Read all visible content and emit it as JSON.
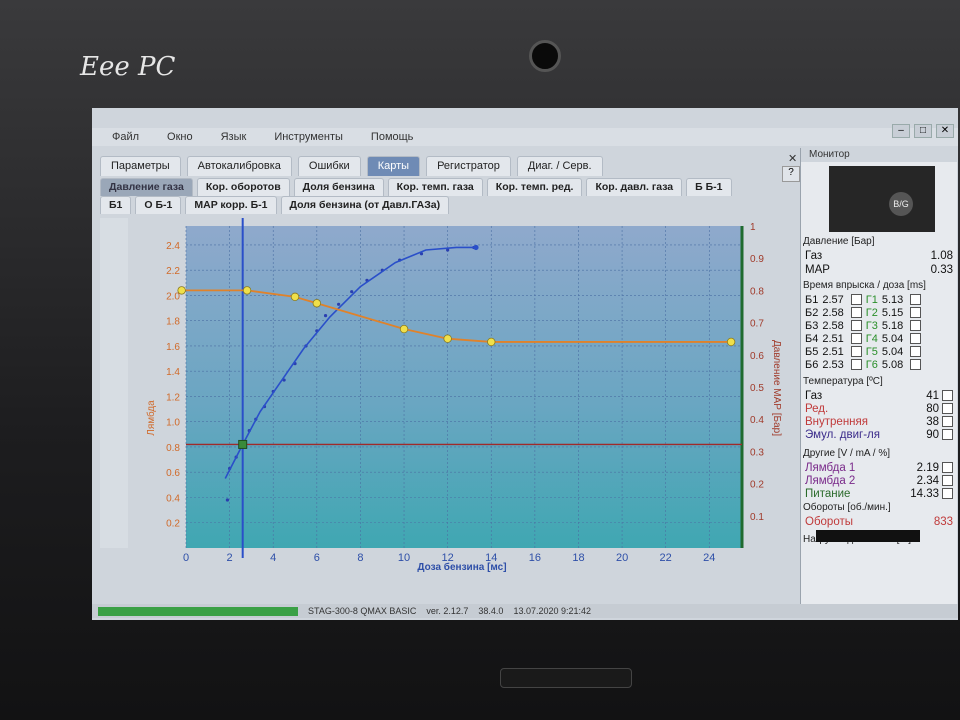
{
  "device": {
    "brand": "Eee PC"
  },
  "menu": {
    "items": [
      "Файл",
      "Окно",
      "Язык",
      "Инструменты",
      "Помощь"
    ]
  },
  "tabs_main": [
    {
      "label": "Параметры",
      "active": false
    },
    {
      "label": "Автокалибровка",
      "active": false
    },
    {
      "label": "Ошибки",
      "active": false
    },
    {
      "label": "Карты",
      "active": true
    },
    {
      "label": "Регистратор",
      "active": false
    },
    {
      "label": "Диаг. / Серв.",
      "active": false
    }
  ],
  "tabs_maps_row1": [
    {
      "label": "Давление газа",
      "selected": true
    },
    {
      "label": "Кор. оборотов",
      "selected": false
    },
    {
      "label": "Доля бензина",
      "selected": false
    },
    {
      "label": "Кор. темп. газа",
      "selected": false
    },
    {
      "label": "Кор. темп. ред.",
      "selected": false
    },
    {
      "label": "Кор. давл. газа",
      "selected": false
    },
    {
      "label": "Б Б-1",
      "selected": false
    }
  ],
  "tabs_maps_row2": [
    {
      "label": "Б1",
      "selected": false
    },
    {
      "label": "О Б-1",
      "selected": false
    },
    {
      "label": "MAP корр. Б-1",
      "selected": false
    },
    {
      "label": "Доля бензина (от Давл.ГАЗа)",
      "selected": false
    }
  ],
  "chart_data": {
    "type": "line",
    "xlabel": "Доза бензина [мс]",
    "ylabel_left": "Лямбда",
    "ylabel_right": "Давление МАР [Бар]",
    "x_ticks": [
      0,
      2,
      4,
      6,
      8,
      10,
      12,
      14,
      16,
      18,
      20,
      22,
      24
    ],
    "y_left_ticks": [
      0.2,
      0.4,
      0.6,
      0.8,
      1.0,
      1.2,
      1.4,
      1.6,
      1.8,
      2.0,
      2.2,
      2.4
    ],
    "y_right_ticks": [
      0.1,
      0.2,
      0.3,
      0.4,
      0.5,
      0.6,
      0.7,
      0.8,
      0.9,
      1
    ],
    "xlim": [
      0,
      25.5
    ],
    "ylim_left": [
      0,
      2.55
    ],
    "ylim_right": [
      0,
      1.0
    ],
    "orange_curve": {
      "x": [
        -0.2,
        2.8,
        5,
        6,
        10,
        12,
        14,
        25
      ],
      "y": [
        0.8,
        0.8,
        0.78,
        0.76,
        0.68,
        0.65,
        0.64,
        0.64
      ]
    },
    "blue_curve": {
      "x": [
        1.8,
        2.6,
        3.4,
        4.4,
        5.4,
        6.6,
        8,
        9.6,
        11,
        12.4,
        13.3
      ],
      "y": [
        0.55,
        0.82,
        1.08,
        1.33,
        1.58,
        1.83,
        2.07,
        2.26,
        2.36,
        2.38,
        2.38
      ]
    },
    "scatter": {
      "x": [
        1.9,
        2.0,
        2.3,
        2.6,
        2.9,
        3.2,
        3.6,
        4.0,
        4.5,
        5.0,
        5.5,
        6.0,
        6.4,
        7.0,
        7.6,
        8.3,
        9.0,
        9.8,
        10.8,
        12.0,
        13.2
      ],
      "y": [
        0.38,
        0.63,
        0.72,
        0.8,
        0.93,
        1.02,
        1.12,
        1.24,
        1.33,
        1.46,
        1.6,
        1.72,
        1.84,
        1.93,
        2.03,
        2.12,
        2.2,
        2.28,
        2.33,
        2.36,
        2.38
      ]
    },
    "cursor_x": 2.6,
    "cursor_y": 0.82,
    "colors": {
      "orange": "#e0822a",
      "blue": "#2a4fc9",
      "red": "#a02a2a",
      "grid": "#4b6fa3"
    }
  },
  "monitor": {
    "title": "Монитор",
    "bg_label": "B/G",
    "pressure_section": "Давление [Бар]",
    "gas_label": "Газ",
    "gas_value": "1.08",
    "map_label": "MAP",
    "map_value": "0.33",
    "inj_section": "Время впрыска / доза [ms]",
    "injectors": [
      {
        "b": "Б1",
        "bv": "2.57",
        "g": "Г1",
        "gv": "5.13"
      },
      {
        "b": "Б2",
        "bv": "2.58",
        "g": "Г2",
        "gv": "5.15"
      },
      {
        "b": "Б3",
        "bv": "2.58",
        "g": "Г3",
        "gv": "5.18"
      },
      {
        "b": "Б4",
        "bv": "2.51",
        "g": "Г4",
        "gv": "5.04"
      },
      {
        "b": "Б5",
        "bv": "2.51",
        "g": "Г5",
        "gv": "5.04"
      },
      {
        "b": "Б6",
        "bv": "2.53",
        "g": "Г6",
        "gv": "5.08"
      }
    ],
    "temp_section": "Температура [ºC]",
    "temps": [
      {
        "label": "Газ",
        "value": "41",
        "color": "#111"
      },
      {
        "label": "Ред.",
        "value": "80",
        "color": "#c03a3a"
      },
      {
        "label": "Внутренняя",
        "value": "38",
        "color": "#c03a3a"
      },
      {
        "label": "Эмул. двиг-ля",
        "value": "90",
        "color": "#3a2a8a"
      }
    ],
    "other_section": "Другие [V / mA / %]",
    "others": [
      {
        "label": "Лямбда 1",
        "value": "2.19",
        "color": "#7a2a8a"
      },
      {
        "label": "Лямбда 2",
        "value": "2.34",
        "color": "#7a2a8a"
      },
      {
        "label": "Питание",
        "value": "14.33",
        "color": "#2a6a2a"
      }
    ],
    "rpm_section": "Обороты [об./мин.]",
    "rpm_label": "Обороты",
    "rpm_value": "833",
    "load_section": "Нагрузка двигателя [%]"
  },
  "status": {
    "text": "STAG-300-8 QMAX BASIC",
    "version": "ver. 2.12.7",
    "code": "38.4.0",
    "datetime": "13.07.2020 9:21:42"
  }
}
